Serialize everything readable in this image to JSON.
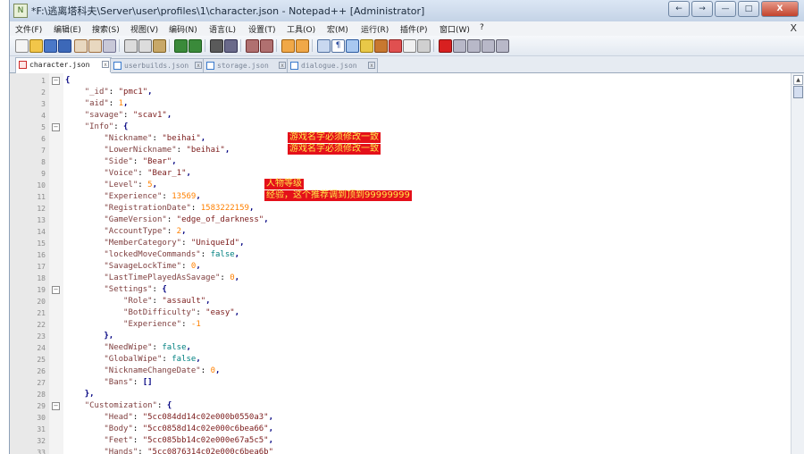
{
  "window": {
    "title": "*F:\\逃离塔科夫\\Server\\user\\profiles\\1\\character.json - Notepad++ [Administrator]",
    "controls": [
      "←",
      "→",
      "—",
      "□",
      "X"
    ]
  },
  "menu": {
    "items": [
      "文件(F)",
      "编辑(E)",
      "搜索(S)",
      "视图(V)",
      "编码(N)",
      "语言(L)",
      "设置(T)",
      "工具(O)",
      "宏(M)",
      "运行(R)",
      "插件(P)",
      "窗口(W)",
      "?"
    ],
    "close_label": "X"
  },
  "tabs": [
    {
      "label": "character.json",
      "active": true
    },
    {
      "label": "userbuilds.json",
      "active": false
    },
    {
      "label": "storage.json",
      "active": false
    },
    {
      "label": "dialogue.json",
      "active": false
    }
  ],
  "code_lines": [
    {
      "n": "1",
      "fold": "minus",
      "t": "{"
    },
    {
      "n": "2",
      "t": "    \"_id\": \"pmc1\","
    },
    {
      "n": "3",
      "t": "    \"aid\": 1,"
    },
    {
      "n": "4",
      "t": "    \"savage\": \"scav1\","
    },
    {
      "n": "5",
      "fold": "minus",
      "t": "    \"Info\": {"
    },
    {
      "n": "6",
      "t": "        \"Nickname\": \"beihai\","
    },
    {
      "n": "7",
      "t": "        \"LowerNickname\": \"beihai\","
    },
    {
      "n": "8",
      "t": "        \"Side\": \"Bear\","
    },
    {
      "n": "9",
      "t": "        \"Voice\": \"Bear_1\","
    },
    {
      "n": "10",
      "t": "        \"Level\": 5,"
    },
    {
      "n": "11",
      "t": "        \"Experience\": 13569,"
    },
    {
      "n": "12",
      "t": "        \"RegistrationDate\": 1583222159,"
    },
    {
      "n": "13",
      "t": "        \"GameVersion\": \"edge_of_darkness\","
    },
    {
      "n": "14",
      "t": "        \"AccountType\": 2,"
    },
    {
      "n": "15",
      "t": "        \"MemberCategory\": \"UniqueId\","
    },
    {
      "n": "16",
      "t": "        \"lockedMoveCommands\": false,"
    },
    {
      "n": "17",
      "t": "        \"SavageLockTime\": 0,"
    },
    {
      "n": "18",
      "t": "        \"LastTimePlayedAsSavage\": 0,"
    },
    {
      "n": "19",
      "fold": "minus",
      "t": "        \"Settings\": {"
    },
    {
      "n": "20",
      "t": "            \"Role\": \"assault\","
    },
    {
      "n": "21",
      "t": "            \"BotDifficulty\": \"easy\","
    },
    {
      "n": "22",
      "t": "            \"Experience\": -1"
    },
    {
      "n": "23",
      "t": "        },"
    },
    {
      "n": "24",
      "t": "        \"NeedWipe\": false,"
    },
    {
      "n": "25",
      "t": "        \"GlobalWipe\": false,"
    },
    {
      "n": "26",
      "t": "        \"NicknameChangeDate\": 0,"
    },
    {
      "n": "27",
      "t": "        \"Bans\": []"
    },
    {
      "n": "28",
      "t": "    },"
    },
    {
      "n": "29",
      "fold": "minus",
      "t": "    \"Customization\": {"
    },
    {
      "n": "30",
      "t": "        \"Head\": \"5cc084dd14c02e000b0550a3\","
    },
    {
      "n": "31",
      "t": "        \"Body\": \"5cc0858d14c02e000c6bea66\","
    },
    {
      "n": "32",
      "t": "        \"Feet\": \"5cc085bb14c02e000e67a5c5\","
    },
    {
      "n": "33",
      "t": "        \"Hands\": \"5cc0876314c02e000c6bea6b\""
    }
  ],
  "annotations": {
    "nickname_note_1": "游戏名字必须修改一致",
    "nickname_note_2": "游戏名字必须修改一致",
    "level_note": "人物等级",
    "experience_note": "经验，这个推荐调到顶到99999999"
  },
  "colors": {
    "key": "#804040",
    "string": "#7b1b1b",
    "number": "#ff8000",
    "boolean": "#008080",
    "annotation_bg": "#e4101a",
    "annotation_text": "#ffe84a"
  }
}
